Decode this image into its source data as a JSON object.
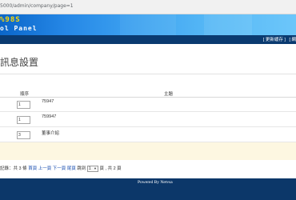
{
  "browser": {
    "url": "5000/admin/company/page=1"
  },
  "banner": {
    "logo_top": "%98S",
    "logo_sub": "ol Panel"
  },
  "topnav": {
    "links": [
      "[ 更新緩存 ]",
      "[ 網"
    ]
  },
  "page": {
    "title": "訊息設置"
  },
  "table": {
    "columns": {
      "order": "順序",
      "subject": "主題"
    },
    "rows": [
      {
        "order": "1",
        "subject": "75947"
      },
      {
        "order": "1",
        "subject": "759947"
      },
      {
        "order": "3",
        "subject": "董事介紹"
      }
    ]
  },
  "pager": {
    "records_prefix": "記錄：共",
    "records_count": "3",
    "records_suffix": "條",
    "first": "首頁",
    "prev": "上一頁",
    "next": "下一頁",
    "last": "尾頁",
    "goto_label": "跳到",
    "page_value": "1",
    "page_suffix": "頁 , 共",
    "total_pages": "2",
    "total_suffix": "頁"
  },
  "footer": {
    "powered_by": "Powered By Netvsa"
  },
  "colors": {
    "banner": "#2587e6",
    "nav": "#0a3a70",
    "footer": "#0c3769",
    "logo": "#ffd800",
    "notice": "#fdf7e1"
  }
}
